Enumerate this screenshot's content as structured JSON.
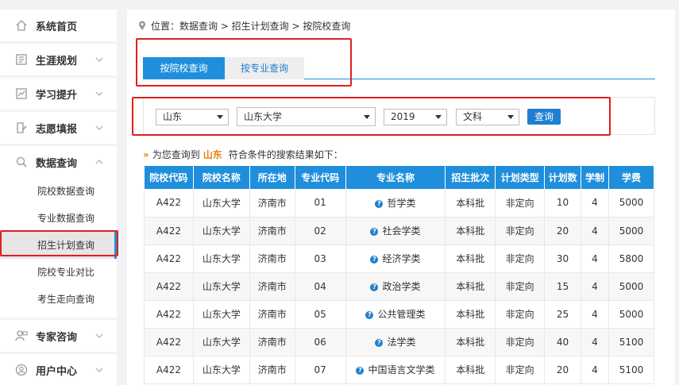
{
  "sidebar": {
    "items": [
      {
        "label": "系统首页",
        "icon": "home-icon"
      },
      {
        "label": "生涯规划",
        "icon": "career-icon"
      },
      {
        "label": "学习提升",
        "icon": "chart-icon"
      },
      {
        "label": "志愿填报",
        "icon": "edit-icon"
      },
      {
        "label": "数据查询",
        "icon": "search-icon"
      },
      {
        "label": "专家咨询",
        "icon": "expert-icon"
      },
      {
        "label": "用户中心",
        "icon": "user-icon"
      }
    ],
    "sub_items": [
      "院校数据查询",
      "专业数据查询",
      "招生计划查询",
      "院校专业对比",
      "考生走向查询"
    ]
  },
  "breadcrumb": "位置：数据查询 > 招生计划查询 > 按院校查询",
  "tabs": [
    "按院校查询",
    "按专业查询"
  ],
  "filters": {
    "province": "山东",
    "school": "山东大学",
    "year": "2019",
    "category": "文科",
    "query_label": "查询"
  },
  "result": {
    "prefix": "为您查询到",
    "province": "山东",
    "suffix": "符合条件的搜索结果如下："
  },
  "table": {
    "headers": [
      "院校代码",
      "院校名称",
      "所在地",
      "专业代码",
      "专业名称",
      "招生批次",
      "计划类型",
      "计划数",
      "学制",
      "学费"
    ],
    "rows": [
      [
        "A422",
        "山东大学",
        "济南市",
        "01",
        "哲学类",
        "本科批",
        "非定向",
        "10",
        "4",
        "5000"
      ],
      [
        "A422",
        "山东大学",
        "济南市",
        "02",
        "社会学类",
        "本科批",
        "非定向",
        "20",
        "4",
        "5000"
      ],
      [
        "A422",
        "山东大学",
        "济南市",
        "03",
        "经济学类",
        "本科批",
        "非定向",
        "30",
        "4",
        "5800"
      ],
      [
        "A422",
        "山东大学",
        "济南市",
        "04",
        "政治学类",
        "本科批",
        "非定向",
        "15",
        "4",
        "5000"
      ],
      [
        "A422",
        "山东大学",
        "济南市",
        "05",
        "公共管理类",
        "本科批",
        "非定向",
        "25",
        "4",
        "5000"
      ],
      [
        "A422",
        "山东大学",
        "济南市",
        "06",
        "法学类",
        "本科批",
        "非定向",
        "40",
        "4",
        "5100"
      ],
      [
        "A422",
        "山东大学",
        "济南市",
        "07",
        "中国语言文学类",
        "本科批",
        "非定向",
        "20",
        "4",
        "5100"
      ]
    ]
  },
  "colors": {
    "accent": "#1f8fdc",
    "highlight": "#e8800c",
    "annotation": "#e11f1f"
  }
}
